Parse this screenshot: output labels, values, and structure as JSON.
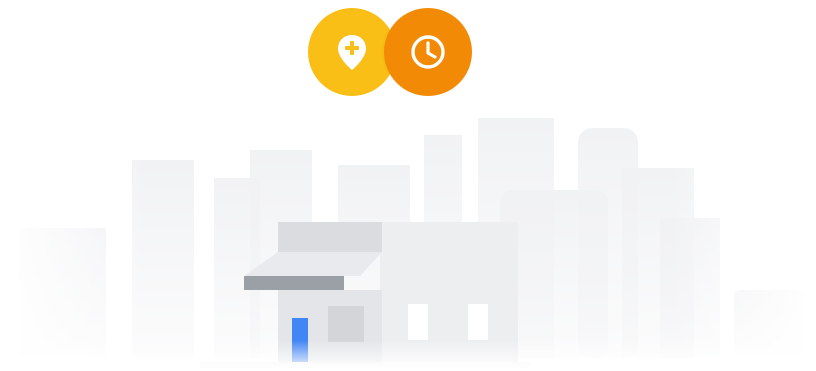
{
  "badges": [
    {
      "icon": "add-location-icon",
      "color": "#F9BF16"
    },
    {
      "icon": "clock-icon",
      "color": "#F28A05"
    }
  ],
  "colors": {
    "skyline": "#F1F2F4",
    "store_wall": "#E8EAED",
    "store_dark": "#DADCE0",
    "awning": "#BDC1C6",
    "awning_edge": "#9AA0A6",
    "door": "#4285F4"
  }
}
